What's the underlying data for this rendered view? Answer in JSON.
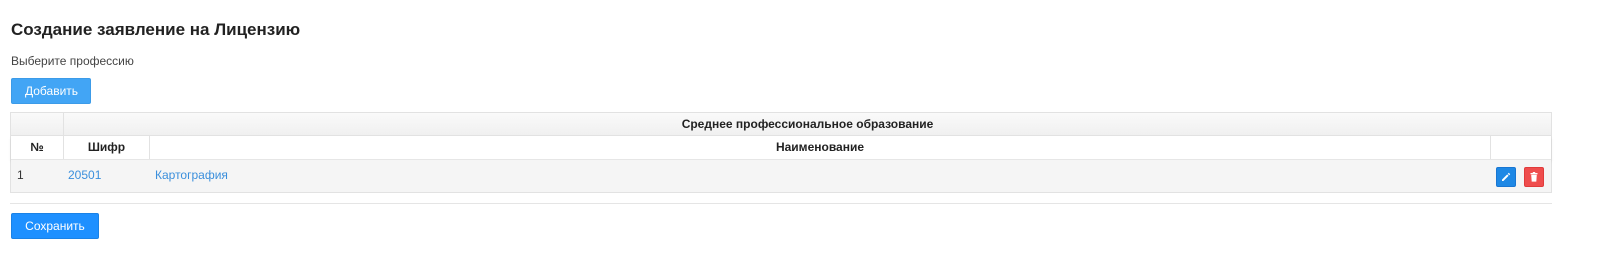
{
  "header": {
    "title": "Создание заявление на Лицензию",
    "subtitle": "Выберите профессию"
  },
  "toolbar": {
    "add_label": "Добавить"
  },
  "table": {
    "group_title": "Среднее профессиональное образование",
    "columns": [
      "№",
      "Шифр",
      "Наименование"
    ],
    "rows": [
      {
        "num": "1",
        "code": "20501",
        "name": "Картография"
      }
    ]
  },
  "icons": {
    "edit": "pencil-icon",
    "delete": "trash-icon"
  },
  "colors": {
    "primary": "#1e90ff",
    "add_button": "#42a5f5",
    "link": "#3b8fdc",
    "delete": "#ef4d4d"
  },
  "footer": {
    "save_label": "Сохранить"
  }
}
